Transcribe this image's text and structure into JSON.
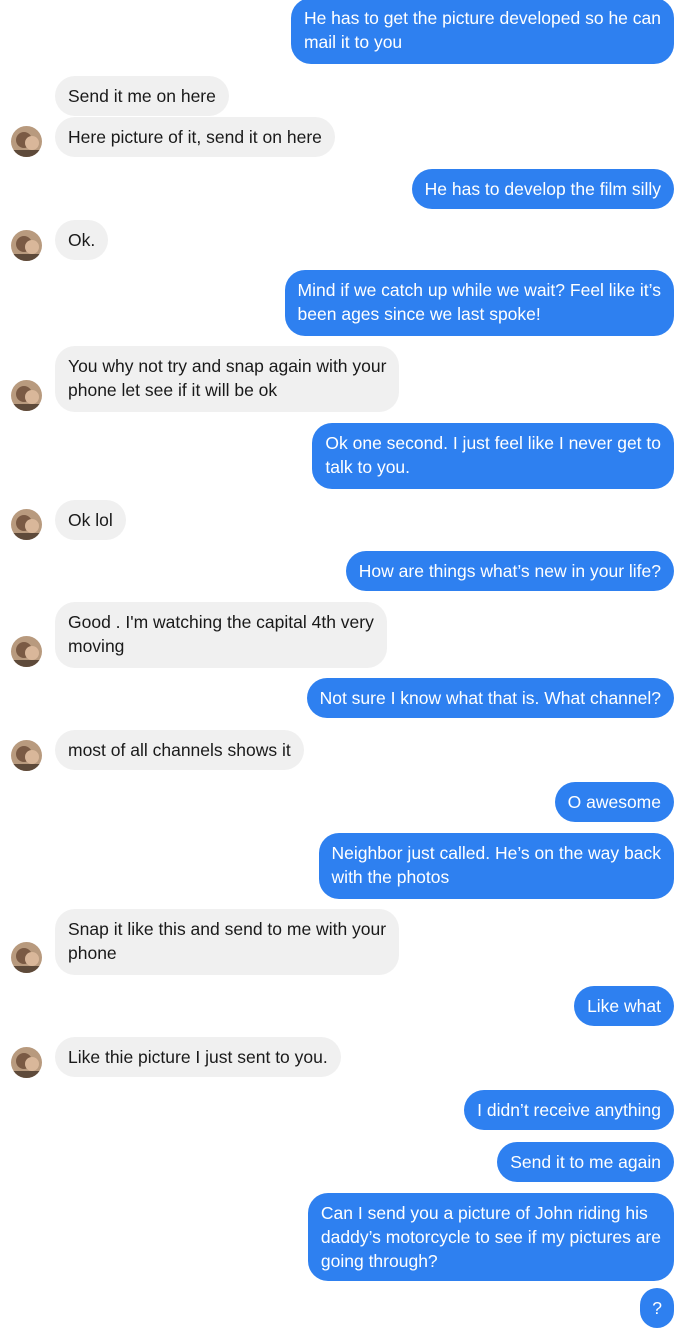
{
  "conversation": {
    "messages": [
      {
        "from": "me",
        "text": "He has to get the picture developed so he can\nmail it to you"
      },
      {
        "from": "them",
        "text": "Send it me on here"
      },
      {
        "from": "them",
        "text": "Here picture of it, send it on here"
      },
      {
        "from": "me",
        "text": "He has to develop the film silly"
      },
      {
        "from": "them",
        "text": "Ok."
      },
      {
        "from": "me",
        "text": "Mind if we catch up while we wait? Feel like it’s\nbeen ages since we last spoke!"
      },
      {
        "from": "them",
        "text": "You why not try and snap again with your\nphone let see if it will be ok"
      },
      {
        "from": "me",
        "text": "Ok one second. I just feel like I never get to\ntalk to you."
      },
      {
        "from": "them",
        "text": "Ok lol"
      },
      {
        "from": "me",
        "text": "How are things what’s new in your life?"
      },
      {
        "from": "them",
        "text": "Good . I'm watching the capital 4th very\nmoving"
      },
      {
        "from": "me",
        "text": "Not sure I know what that is. What channel?"
      },
      {
        "from": "them",
        "text": "most of all channels shows it"
      },
      {
        "from": "me",
        "text": "O awesome"
      },
      {
        "from": "me",
        "text": "Neighbor just called. He’s on the way back\nwith the photos"
      },
      {
        "from": "them",
        "text": "Snap it like this and send to me with your\nphone"
      },
      {
        "from": "me",
        "text": "Like what"
      },
      {
        "from": "them",
        "text": "Like thie picture I just sent to you."
      },
      {
        "from": "me",
        "text": "I didn’t receive anything"
      },
      {
        "from": "me",
        "text": "Send it to me again"
      },
      {
        "from": "me",
        "text": "Can I send you a picture of John riding his\ndaddy’s motorcycle to see if my pictures are\ngoing through?"
      },
      {
        "from": "me",
        "text": "?"
      }
    ]
  },
  "colors": {
    "outgoing_bubble": "#2e80f0",
    "incoming_bubble": "#f0f0f0",
    "outgoing_text": "#ffffff",
    "incoming_text": "#1a1a1a"
  },
  "icons": {
    "contact_avatar": "contact-avatar-photo"
  }
}
